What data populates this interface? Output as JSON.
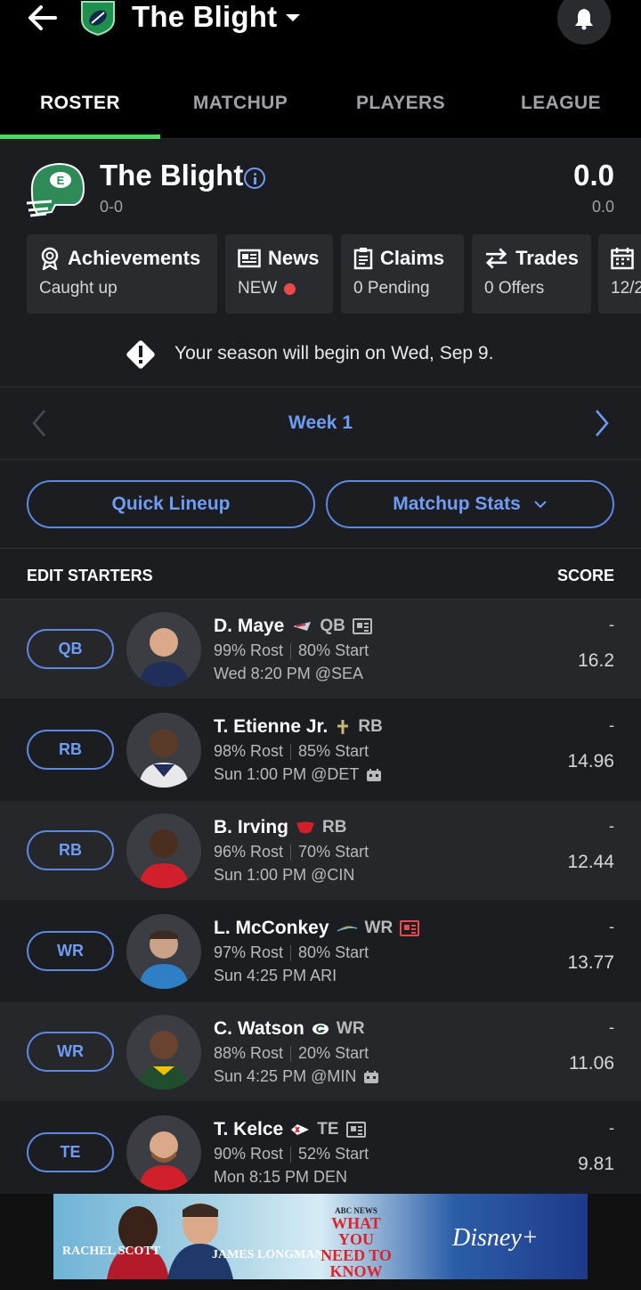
{
  "header": {
    "title": "The Blight"
  },
  "tabs": [
    {
      "label": "ROSTER",
      "active": true
    },
    {
      "label": "MATCHUP"
    },
    {
      "label": "PLAYERS"
    },
    {
      "label": "LEAGUE"
    }
  ],
  "team": {
    "name": "The Blight",
    "record": "0-0",
    "score": "0.0",
    "projected": "0.0"
  },
  "cards": [
    {
      "title": "Achievements",
      "sub": "Caught up",
      "icon": "award-icon"
    },
    {
      "title": "News",
      "sub": "NEW",
      "icon": "news-icon"
    },
    {
      "title": "Claims",
      "sub": "0 Pending",
      "icon": "clipboard-icon"
    },
    {
      "title": "Trades",
      "sub": "0 Offers",
      "icon": "swap-icon"
    },
    {
      "title": "",
      "sub": "12/2",
      "icon": "calendar-icon"
    }
  ],
  "notice": "Your season will begin on Wed, Sep 9.",
  "week": {
    "label": "Week 1"
  },
  "buttons": {
    "quick_lineup": "Quick Lineup",
    "matchup_stats": "Matchup Stats"
  },
  "table": {
    "edit_label": "EDIT STARTERS",
    "score_label": "SCORE"
  },
  "players": [
    {
      "slot": "QB",
      "name": "D. Maye",
      "pos": "QB",
      "rost": "99% Rost",
      "start": "80% Start",
      "game": "Wed 8:20 PM @SEA",
      "dash": "-",
      "score": "16.2",
      "news": "normal"
    },
    {
      "slot": "RB",
      "name": "T. Etienne Jr.",
      "pos": "RB",
      "rost": "98% Rost",
      "start": "85% Start",
      "game": "Sun 1:00 PM @DET",
      "dash": "-",
      "score": "14.96",
      "news": "none"
    },
    {
      "slot": "RB",
      "name": "B. Irving",
      "pos": "RB",
      "rost": "96% Rost",
      "start": "70% Start",
      "game": "Sun 1:00 PM @CIN",
      "dash": "-",
      "score": "12.44",
      "news": "none"
    },
    {
      "slot": "WR",
      "name": "L. McConkey",
      "pos": "WR",
      "rost": "97% Rost",
      "start": "80% Start",
      "game": "Sun 4:25 PM ARI",
      "dash": "-",
      "score": "13.77",
      "news": "hot"
    },
    {
      "slot": "WR",
      "name": "C. Watson",
      "pos": "WR",
      "rost": "88% Rost",
      "start": "20% Start",
      "game": "Sun 4:25 PM @MIN",
      "dash": "-",
      "score": "11.06",
      "news": "none"
    },
    {
      "slot": "TE",
      "name": "T. Kelce",
      "pos": "TE",
      "rost": "90% Rost",
      "start": "52% Start",
      "game": "Mon 8:15 PM DEN",
      "dash": "-",
      "score": "9.81",
      "news": "normal"
    }
  ],
  "ad": {
    "left_name": "RACHEL SCOTT",
    "mid_name": "JAMES LONGMAN",
    "network": "ABC NEWS",
    "show": "WHAT YOU NEED TO KNOW",
    "brand": "Disney+"
  },
  "colors": {
    "accent": "#6f9cf5",
    "tab_indicator": "#4cd964",
    "alert": "#e84a4a",
    "bg": "#1c1d20"
  }
}
